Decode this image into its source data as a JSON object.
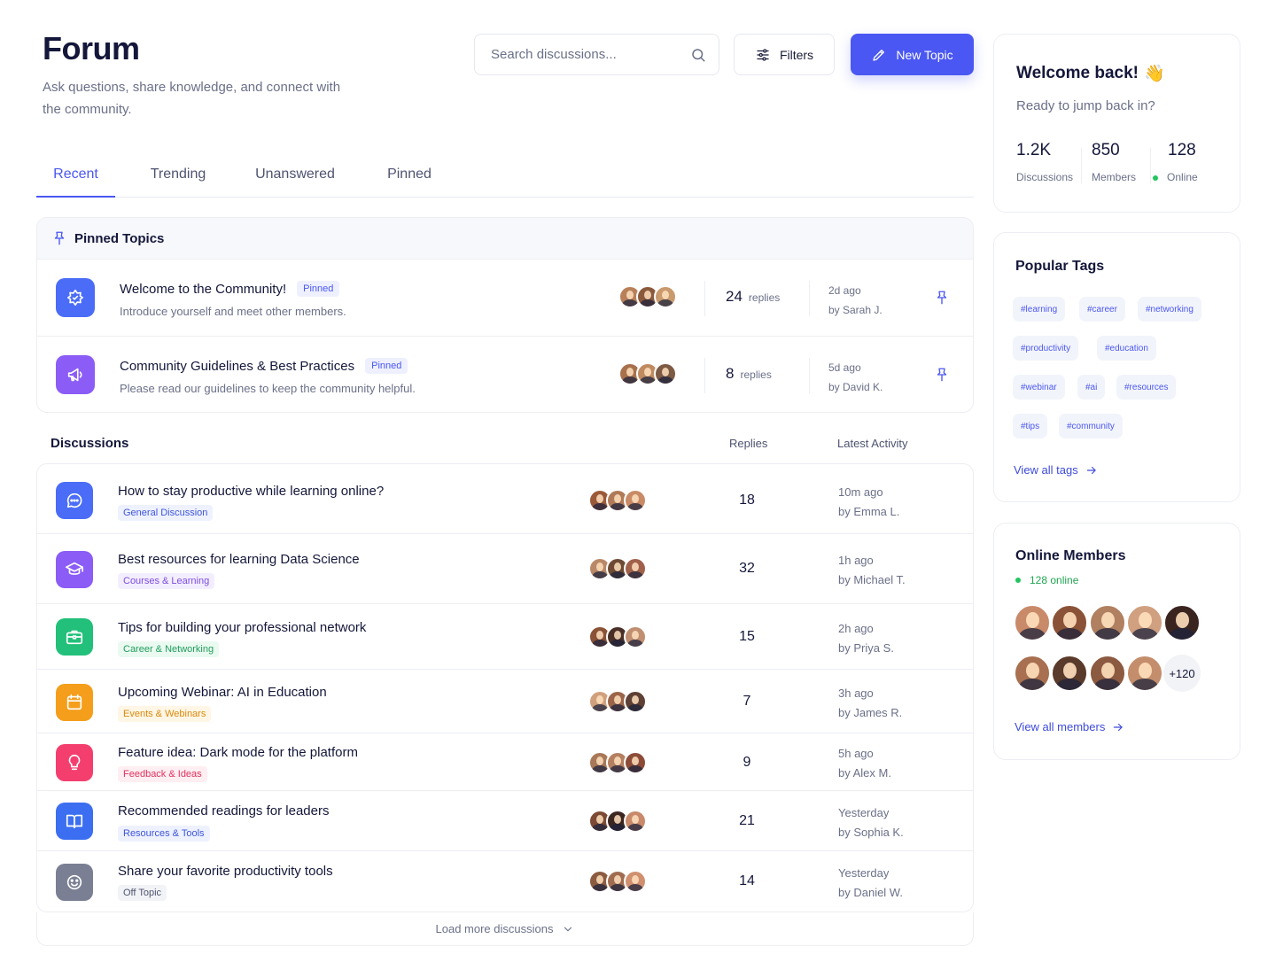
{
  "header": {
    "title": "Forum",
    "subtitle": "Ask questions, share knowledge, and connect with the community.",
    "search_placeholder": "Search discussions...",
    "filters_label": "Filters",
    "new_topic_label": "New Topic"
  },
  "tabs": [
    {
      "label": "Recent",
      "active": true
    },
    {
      "label": "Trending",
      "active": false
    },
    {
      "label": "Unanswered",
      "active": false
    },
    {
      "label": "Pinned",
      "active": false
    }
  ],
  "pinned": {
    "heading": "Pinned Topics",
    "topics": [
      {
        "title": "Welcome to the Community!",
        "badge": "Pinned",
        "description": "Introduce yourself and meet other members.",
        "replies": "24",
        "replies_label": "replies",
        "time": "2d ago",
        "author": "by Sarah J.",
        "icon": "flower-icon",
        "color": "#4a6cf7"
      },
      {
        "title": "Community Guidelines & Best Practices",
        "badge": "Pinned",
        "description": "Please read our guidelines to keep the community helpful.",
        "replies": "8",
        "replies_label": "replies",
        "time": "5d ago",
        "author": "by David K.",
        "icon": "megaphone-icon",
        "color": "#8b5cf6"
      }
    ]
  },
  "discussions": {
    "heading": "Discussions",
    "col_replies": "Replies",
    "col_activity": "Latest Activity",
    "items": [
      {
        "title": "How to stay productive while learning online?",
        "category": "General Discussion",
        "replies": "18",
        "time": "10m ago",
        "author": "by Emma L.",
        "icon": "chat-bubble-icon",
        "color": "#4a6cf7",
        "cat_bg": "#eef1ff",
        "cat_color": "#3d55d9"
      },
      {
        "title": "Best resources for learning Data Science",
        "category": "Courses & Learning",
        "replies": "32",
        "time": "1h ago",
        "author": "by Michael T.",
        "icon": "graduation-cap-icon",
        "color": "#8b5cf6",
        "cat_bg": "#f3eeff",
        "cat_color": "#7c4ce0"
      },
      {
        "title": "Tips for building your professional network",
        "category": "Career & Networking",
        "replies": "15",
        "time": "2h ago",
        "author": "by Priya S.",
        "icon": "briefcase-icon",
        "color": "#22c07a",
        "cat_bg": "#eafaf1",
        "cat_color": "#1f9d5c"
      },
      {
        "title": "Upcoming Webinar: AI in Education",
        "category": "Events & Webinars",
        "replies": "7",
        "time": "3h ago",
        "author": "by James R.",
        "icon": "calendar-icon",
        "color": "#f59e1b",
        "cat_bg": "#fff6e6",
        "cat_color": "#d98a0c"
      },
      {
        "title": "Feature idea: Dark mode for the platform",
        "category": "Feedback & Ideas",
        "replies": "9",
        "time": "5h ago",
        "author": "by Alex M.",
        "icon": "lightbulb-icon",
        "color": "#f43f6e",
        "cat_bg": "#ffeef2",
        "cat_color": "#e0325f"
      },
      {
        "title": "Recommended readings for leaders",
        "category": "Resources & Tools",
        "replies": "21",
        "time": "Yesterday",
        "author": "by Sophia K.",
        "icon": "book-icon",
        "color": "#3b6ef0",
        "cat_bg": "#eef1ff",
        "cat_color": "#3d55d9"
      },
      {
        "title": "Share your favorite productivity tools",
        "category": "Off Topic",
        "replies": "14",
        "time": "Yesterday",
        "author": "by Daniel W.",
        "icon": "smiley-icon",
        "color": "#7a7f93",
        "cat_bg": "#f2f3f6",
        "cat_color": "#4e5370"
      }
    ],
    "load_more_label": "Load more discussions"
  },
  "sidebar": {
    "welcome": {
      "title": "Welcome back!",
      "emoji": "👋",
      "subtitle": "Ready to jump back in?",
      "stats": [
        {
          "value": "1.2K",
          "label": "Discussions"
        },
        {
          "value": "850",
          "label": "Members"
        },
        {
          "value": "128",
          "label": "Online"
        }
      ]
    },
    "tags": {
      "title": "Popular Tags",
      "items": [
        "#learning",
        "#career",
        "#networking",
        "#productivity",
        "#education",
        "#webinar",
        "#ai",
        "#resources",
        "#tips",
        "#community"
      ],
      "view_all_label": "View all tags"
    },
    "online": {
      "title": "Online Members",
      "count_label": "128 online",
      "more_label": "+120",
      "view_all_label": "View all members"
    }
  },
  "colors": {
    "accent": "#4a57f2",
    "online": "#22c55e"
  }
}
